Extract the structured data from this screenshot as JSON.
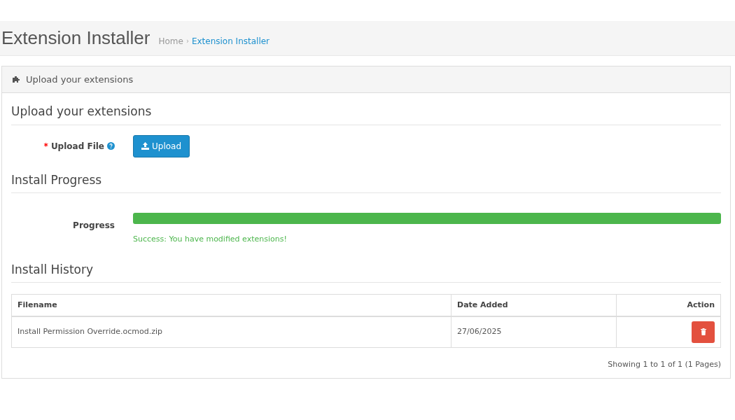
{
  "page_title": "Extension Installer",
  "breadcrumb": [
    {
      "label": "Home",
      "current": false
    },
    {
      "label": "Extension Installer",
      "current": true
    }
  ],
  "breadcrumb_separator": "›",
  "panel": {
    "title": "Upload your extensions"
  },
  "upload_section": {
    "heading": "Upload your extensions",
    "required_mark": "*",
    "label": "Upload File",
    "button": "Upload"
  },
  "progress_section": {
    "heading": "Install Progress",
    "label": "Progress",
    "level": 1,
    "message": "Success: You have modified extensions!"
  },
  "history_section": {
    "heading": "Install History",
    "columns": [
      "Filename",
      "Date Added",
      "Action"
    ],
    "rows": [
      {
        "filename": "Install Permission Override.ocmod.zip",
        "date_added": "27/06/2025"
      }
    ],
    "pagination": "Showing 1 to 1 of 1 (1 Pages)"
  }
}
